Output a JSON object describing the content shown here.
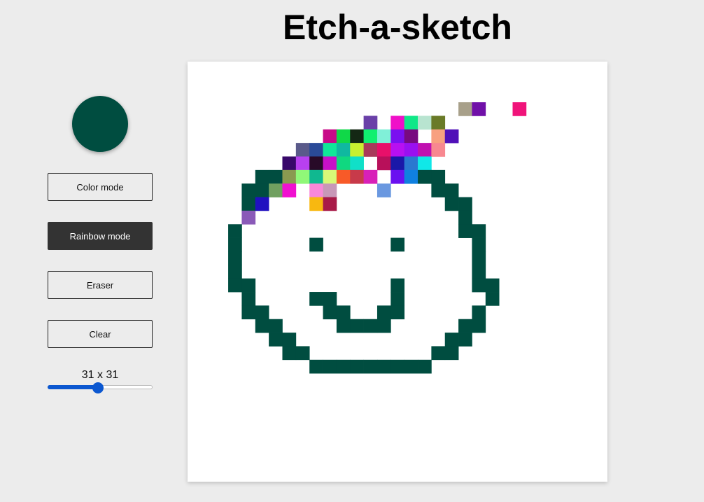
{
  "title": "Etch-a-sketch",
  "color_picker": {
    "value": "#004d40"
  },
  "buttons": {
    "color_mode": "Color mode",
    "rainbow_mode": "Rainbow mode",
    "eraser": "Eraser",
    "clear": "Clear"
  },
  "active_mode": "rainbow",
  "grid": {
    "size_label": "31 x 31",
    "size": 31,
    "slider_min": 1,
    "slider_max": 64,
    "slider_value": 31,
    "cells": [
      [
        3,
        20,
        "#a8a08a"
      ],
      [
        3,
        21,
        "#7010a8"
      ],
      [
        3,
        24,
        "#f0147a"
      ],
      [
        4,
        13,
        "#6a40a8"
      ],
      [
        4,
        15,
        "#f010c8"
      ],
      [
        4,
        16,
        "#10e888"
      ],
      [
        4,
        17,
        "#b8e4d0"
      ],
      [
        4,
        18,
        "#6a7a28"
      ],
      [
        5,
        10,
        "#c80a88"
      ],
      [
        5,
        11,
        "#10d848"
      ],
      [
        5,
        12,
        "#142814"
      ],
      [
        5,
        13,
        "#10f070"
      ],
      [
        5,
        14,
        "#80f0d8"
      ],
      [
        5,
        15,
        "#7a10f0"
      ],
      [
        5,
        16,
        "#780a80"
      ],
      [
        5,
        18,
        "#f8a080"
      ],
      [
        5,
        19,
        "#5010b8"
      ],
      [
        6,
        8,
        "#5a5a8a"
      ],
      [
        6,
        9,
        "#2a4a98"
      ],
      [
        6,
        10,
        "#10e898"
      ],
      [
        6,
        11,
        "#10b8a0"
      ],
      [
        6,
        12,
        "#c8f030"
      ],
      [
        6,
        13,
        "#a83a5a"
      ],
      [
        6,
        14,
        "#e8106a"
      ],
      [
        6,
        15,
        "#b810f0"
      ],
      [
        6,
        16,
        "#9a10f0"
      ],
      [
        6,
        17,
        "#c010b0"
      ],
      [
        6,
        18,
        "#f88890"
      ],
      [
        7,
        7,
        "#38086a"
      ],
      [
        7,
        8,
        "#b840f0"
      ],
      [
        7,
        9,
        "#280a28"
      ],
      [
        7,
        10,
        "#c810c8"
      ],
      [
        7,
        11,
        "#10d880"
      ],
      [
        7,
        12,
        "#10e0c8"
      ],
      [
        7,
        14,
        "#b8105a"
      ],
      [
        7,
        15,
        "#1a18a8"
      ],
      [
        7,
        16,
        "#2a78d0"
      ],
      [
        7,
        17,
        "#10e8e8"
      ],
      [
        8,
        5,
        "#004d40"
      ],
      [
        8,
        6,
        "#004d40"
      ],
      [
        8,
        7,
        "#8a9a50"
      ],
      [
        8,
        8,
        "#90f878"
      ],
      [
        8,
        9,
        "#10b890"
      ],
      [
        8,
        10,
        "#d8f878"
      ],
      [
        8,
        11,
        "#f85a28"
      ],
      [
        8,
        12,
        "#c83a4a"
      ],
      [
        8,
        13,
        "#d820b8"
      ],
      [
        8,
        15,
        "#6a10f0"
      ],
      [
        8,
        16,
        "#1080e0"
      ],
      [
        8,
        17,
        "#004d40"
      ],
      [
        8,
        18,
        "#004d40"
      ],
      [
        9,
        4,
        "#004d40"
      ],
      [
        9,
        5,
        "#004d40"
      ],
      [
        9,
        6,
        "#70a060"
      ],
      [
        9,
        7,
        "#f010d0"
      ],
      [
        9,
        9,
        "#f888d8"
      ],
      [
        9,
        10,
        "#c898b8"
      ],
      [
        9,
        14,
        "#6a98e0"
      ],
      [
        9,
        18,
        "#004d40"
      ],
      [
        9,
        19,
        "#004d40"
      ],
      [
        10,
        4,
        "#004d40"
      ],
      [
        10,
        5,
        "#2010c0"
      ],
      [
        10,
        9,
        "#f8b810"
      ],
      [
        10,
        10,
        "#a81a48"
      ],
      [
        10,
        19,
        "#004d40"
      ],
      [
        10,
        20,
        "#004d40"
      ],
      [
        11,
        4,
        "#8a5ab8"
      ],
      [
        11,
        20,
        "#004d40"
      ],
      [
        12,
        3,
        "#004d40"
      ],
      [
        12,
        20,
        "#004d40"
      ],
      [
        12,
        21,
        "#004d40"
      ],
      [
        13,
        3,
        "#004d40"
      ],
      [
        13,
        9,
        "#004d40"
      ],
      [
        13,
        15,
        "#004d40"
      ],
      [
        13,
        21,
        "#004d40"
      ],
      [
        14,
        3,
        "#004d40"
      ],
      [
        14,
        21,
        "#004d40"
      ],
      [
        15,
        3,
        "#004d40"
      ],
      [
        15,
        21,
        "#004d40"
      ],
      [
        16,
        3,
        "#004d40"
      ],
      [
        16,
        4,
        "#004d40"
      ],
      [
        16,
        15,
        "#004d40"
      ],
      [
        16,
        21,
        "#004d40"
      ],
      [
        16,
        22,
        "#004d40"
      ],
      [
        17,
        4,
        "#004d40"
      ],
      [
        17,
        9,
        "#004d40"
      ],
      [
        17,
        10,
        "#004d40"
      ],
      [
        17,
        15,
        "#004d40"
      ],
      [
        17,
        22,
        "#004d40"
      ],
      [
        18,
        4,
        "#004d40"
      ],
      [
        18,
        5,
        "#004d40"
      ],
      [
        18,
        10,
        "#004d40"
      ],
      [
        18,
        11,
        "#004d40"
      ],
      [
        18,
        14,
        "#004d40"
      ],
      [
        18,
        15,
        "#004d40"
      ],
      [
        18,
        21,
        "#004d40"
      ],
      [
        19,
        5,
        "#004d40"
      ],
      [
        19,
        6,
        "#004d40"
      ],
      [
        19,
        11,
        "#004d40"
      ],
      [
        19,
        12,
        "#004d40"
      ],
      [
        19,
        13,
        "#004d40"
      ],
      [
        19,
        14,
        "#004d40"
      ],
      [
        19,
        20,
        "#004d40"
      ],
      [
        19,
        21,
        "#004d40"
      ],
      [
        20,
        6,
        "#004d40"
      ],
      [
        20,
        7,
        "#004d40"
      ],
      [
        20,
        19,
        "#004d40"
      ],
      [
        20,
        20,
        "#004d40"
      ],
      [
        21,
        7,
        "#004d40"
      ],
      [
        21,
        8,
        "#004d40"
      ],
      [
        21,
        18,
        "#004d40"
      ],
      [
        21,
        19,
        "#004d40"
      ],
      [
        22,
        9,
        "#004d40"
      ],
      [
        22,
        10,
        "#004d40"
      ],
      [
        22,
        11,
        "#004d40"
      ],
      [
        22,
        12,
        "#004d40"
      ],
      [
        22,
        13,
        "#004d40"
      ],
      [
        22,
        14,
        "#004d40"
      ],
      [
        22,
        15,
        "#004d40"
      ],
      [
        22,
        16,
        "#004d40"
      ],
      [
        22,
        17,
        "#004d40"
      ]
    ]
  }
}
